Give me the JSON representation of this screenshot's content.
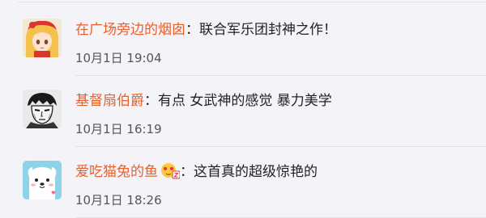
{
  "comments": [
    {
      "avatar_icon": "anime-girl-avatar-icon",
      "username": "在广场旁边的烟囱",
      "separator": "：",
      "text": "联合军乐团封神之作！",
      "time": "10月1日 19:04"
    },
    {
      "avatar_icon": "manga-boy-avatar-icon",
      "username": "基督扇伯爵",
      "separator": "：",
      "text": "有点 女武神的感觉 暴力美学",
      "time": "10月1日 16:19"
    },
    {
      "avatar_icon": "white-dog-avatar-icon",
      "username": "爱吃猫兔的鱼",
      "badge_icon": "emoji-badge-icon",
      "separator": "：",
      "text": "这首真的超级惊艳的",
      "time": "10月1日 18:26"
    }
  ],
  "colors": {
    "background": "#f4f3f8",
    "username": "#e8602c",
    "text": "#222222",
    "time": "#555555",
    "divider": "#e2e1e8"
  }
}
